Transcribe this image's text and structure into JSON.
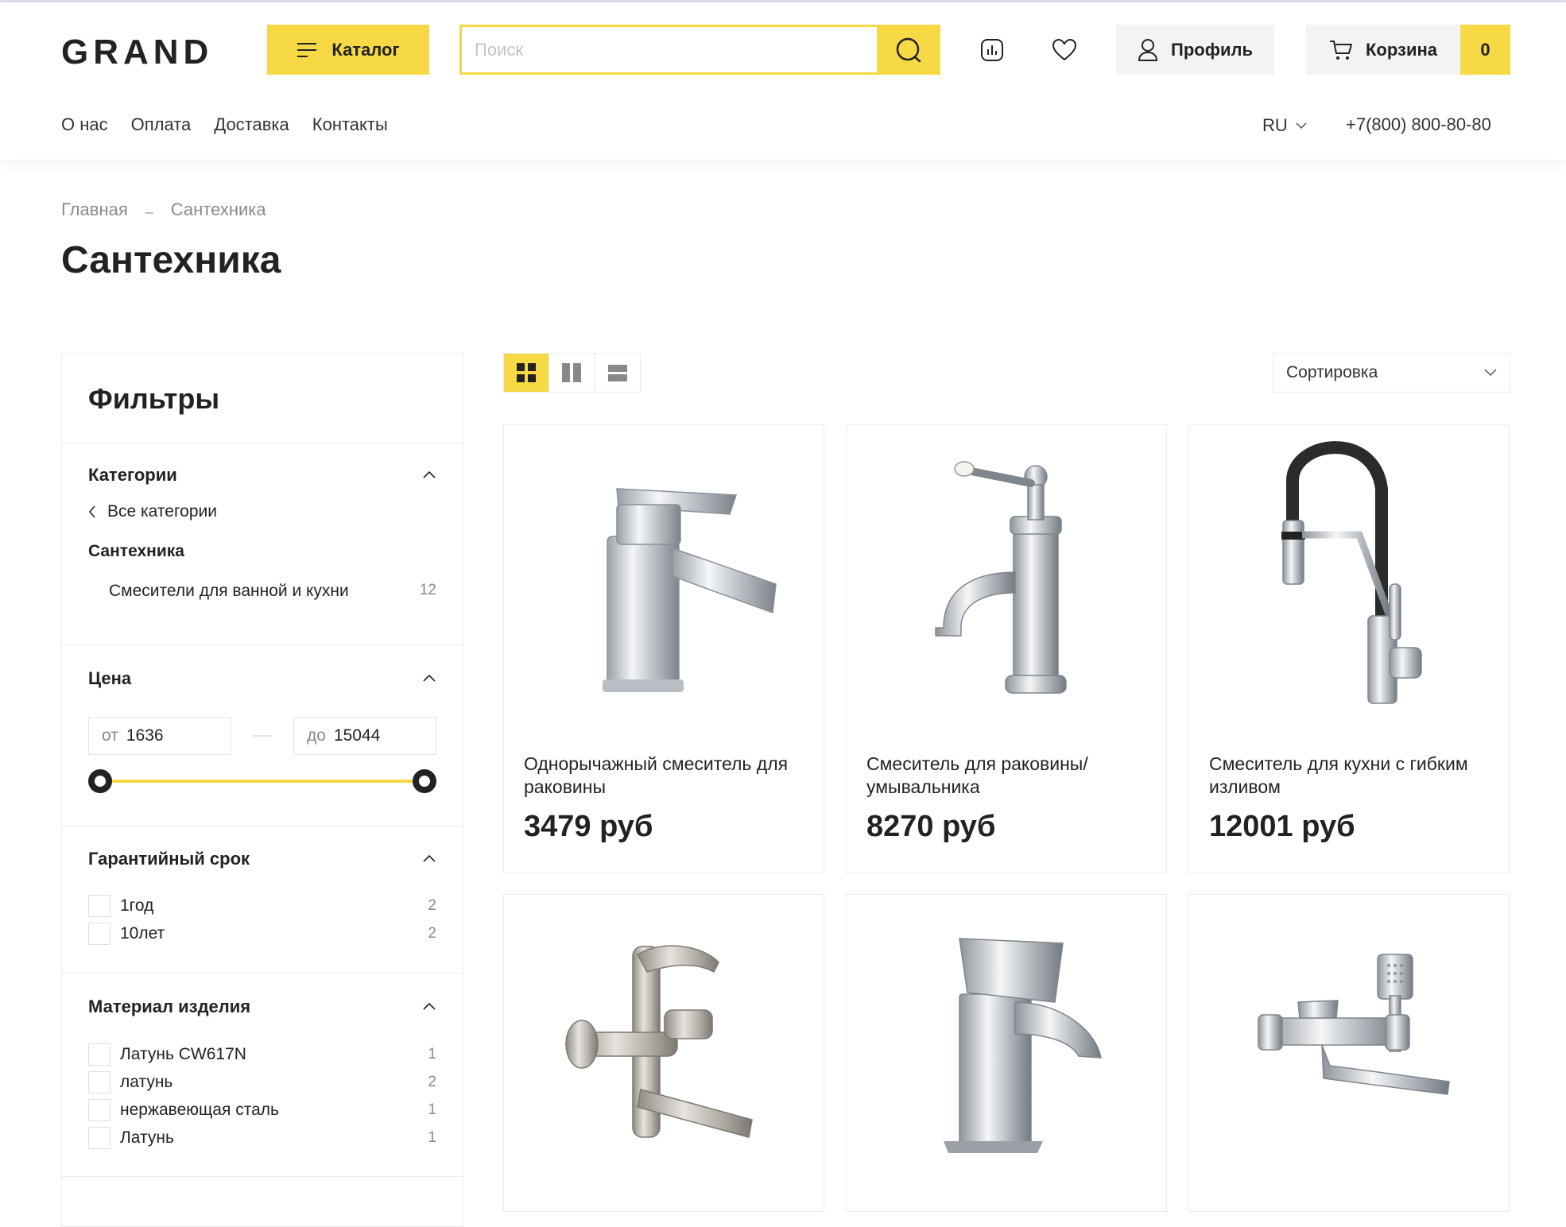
{
  "header": {
    "logo": "GRAND",
    "catalog_label": "Каталог",
    "search_placeholder": "Поиск",
    "profile_label": "Профиль",
    "cart_label": "Корзина",
    "cart_count": "0",
    "nav": [
      "О нас",
      "Оплата",
      "Доставка",
      "Контакты"
    ],
    "lang": "RU",
    "phone": "+7(800) 800-80-80"
  },
  "breadcrumb": [
    "Главная",
    "Сантехника"
  ],
  "page_title": "Сантехника",
  "filters": {
    "title": "Фильтры",
    "categories": {
      "title": "Категории",
      "back_label": "Все категории",
      "current": "Сантехника",
      "sub": [
        {
          "label": "Смесители для ванной и кухни",
          "count": "12"
        }
      ]
    },
    "price": {
      "title": "Цена",
      "from_prefix": "от",
      "from_value": "1636",
      "to_prefix": "до",
      "to_value": "15044"
    },
    "warranty": {
      "title": "Гарантийный срок",
      "options": [
        {
          "label": "1год",
          "count": "2"
        },
        {
          "label": "10лет",
          "count": "2"
        }
      ]
    },
    "material": {
      "title": "Материал изделия",
      "options": [
        {
          "label": "Латунь CW617N",
          "count": "1"
        },
        {
          "label": "латунь",
          "count": "2"
        },
        {
          "label": "нержавеющая сталь",
          "count": "1"
        },
        {
          "label": "Латунь",
          "count": "1"
        }
      ]
    }
  },
  "sort_label": "Сортировка",
  "products": [
    {
      "name": "Однорычажный смеситель для раковины",
      "price": "3479 руб"
    },
    {
      "name": "Смеситель для раковины/умывальника",
      "price": "8270 руб"
    },
    {
      "name": "Смеситель для кухни с гибким изливом",
      "price": "12001 руб"
    },
    {
      "name": "",
      "price": ""
    },
    {
      "name": "",
      "price": ""
    },
    {
      "name": "",
      "price": ""
    }
  ],
  "colors": {
    "accent": "#f6d944",
    "text": "#222222",
    "border": "#ececec"
  }
}
